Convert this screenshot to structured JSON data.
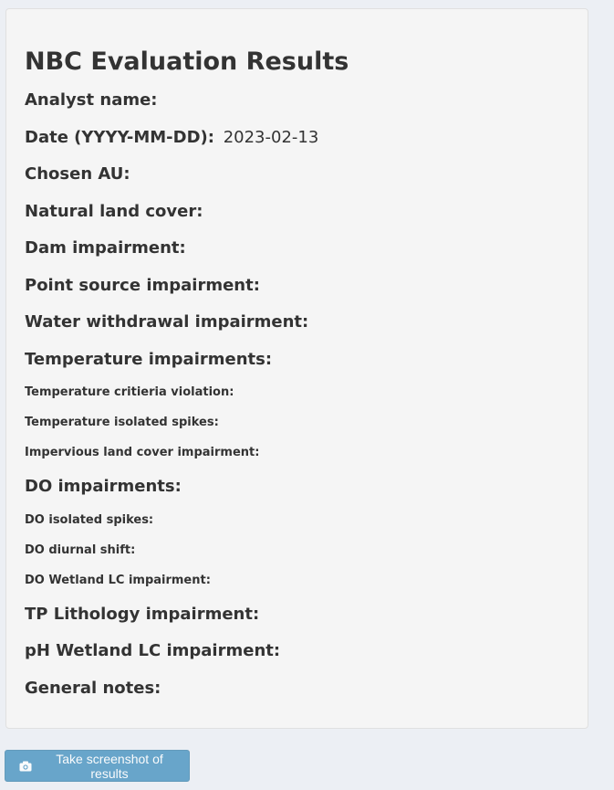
{
  "panel": {
    "title": "NBC Evaluation Results",
    "rows": [
      {
        "label": "Analyst name:",
        "value": "",
        "size": "h4"
      },
      {
        "label": "Date (YYYY-MM-DD):",
        "value": "2023-02-13",
        "size": "h4"
      },
      {
        "label": "Chosen AU:",
        "value": "",
        "size": "h4"
      },
      {
        "label": "Natural land cover:",
        "value": "",
        "size": "h4"
      },
      {
        "label": "Dam impairment:",
        "value": "",
        "size": "h4"
      },
      {
        "label": "Point source impairment:",
        "value": "",
        "size": "h4"
      },
      {
        "label": "Water withdrawal impairment:",
        "value": "",
        "size": "h4"
      },
      {
        "label": "Temperature impairments:",
        "value": "",
        "size": "h4"
      },
      {
        "label": "Temperature critieria violation:",
        "value": "",
        "size": "h5"
      },
      {
        "label": "Temperature isolated spikes:",
        "value": "",
        "size": "h5"
      },
      {
        "label": "Impervious land cover impairment:",
        "value": "",
        "size": "h5"
      },
      {
        "label": "DO impairments:",
        "value": "",
        "size": "h4"
      },
      {
        "label": "DO isolated spikes:",
        "value": "",
        "size": "h5"
      },
      {
        "label": "DO diurnal shift:",
        "value": "",
        "size": "h5"
      },
      {
        "label": "DO Wetland LC impairment:",
        "value": "",
        "size": "h5"
      },
      {
        "label": "TP Lithology impairment:",
        "value": "",
        "size": "h4"
      },
      {
        "label": "pH Wetland LC impairment:",
        "value": "",
        "size": "h4"
      },
      {
        "label": "General notes:",
        "value": "",
        "size": "h4"
      }
    ]
  },
  "screenshot_button": {
    "label": "Take screenshot of results",
    "icon": "camera-icon",
    "color": "#3c8dbc"
  }
}
